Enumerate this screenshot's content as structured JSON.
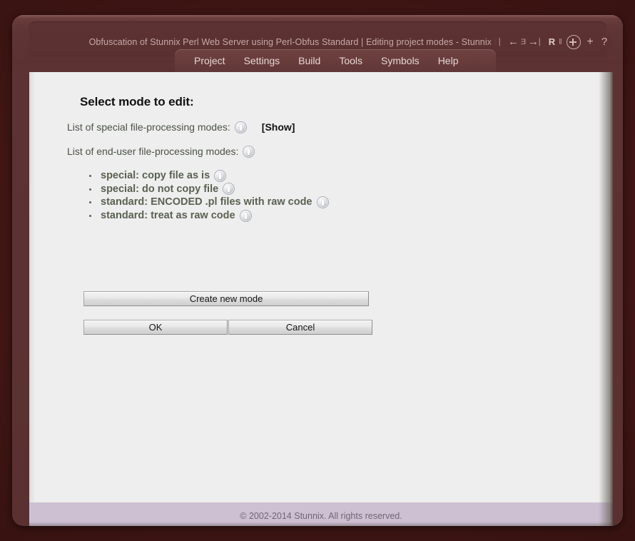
{
  "window": {
    "title": "Obfuscation of Stunnix Perl Web Server using Perl-Obfus Standard | Editing project modes - Stunnix Perl-Obfus P",
    "chrome_icons": [
      {
        "name": "bookmark-icon",
        "glyph": "⎸"
      },
      {
        "name": "back-arrow-icon",
        "glyph": "←"
      },
      {
        "name": "reload-icon",
        "glyph": "Ǝ"
      },
      {
        "name": "forward-arrow-icon",
        "glyph": "→"
      },
      {
        "name": "stop-icon",
        "glyph": "⎸"
      },
      {
        "name": "reader-icon",
        "glyph": "R"
      },
      {
        "name": "pause-icon",
        "glyph": "⏸"
      },
      {
        "name": "zoom-in-icon",
        "glyph": ""
      },
      {
        "name": "new-tab-icon",
        "glyph": "+"
      },
      {
        "name": "help-icon",
        "glyph": "?"
      }
    ]
  },
  "menu": {
    "items": [
      {
        "label": "Project"
      },
      {
        "label": "Settings"
      },
      {
        "label": "Build"
      },
      {
        "label": "Tools"
      },
      {
        "label": "Symbols"
      },
      {
        "label": "Help"
      }
    ]
  },
  "main": {
    "page_title": "Select mode to edit:",
    "special_label": "List of special file-processing modes:",
    "special_show_link": "[Show]",
    "enduser_label": "List of end-user file-processing modes:",
    "modes": [
      {
        "label": "special: copy file as is"
      },
      {
        "label": "special: do not copy file"
      },
      {
        "label": "standard: ENCODED .pl files with raw code"
      },
      {
        "label": "standard: treat as raw code"
      }
    ],
    "create_button": "Create new mode",
    "ok_button": "OK",
    "cancel_button": "Cancel"
  },
  "footer": {
    "copyright": "© 2002-2014 Stunnix. All rights reserved."
  },
  "colors": {
    "frame": "#5b3231",
    "desktop": "#3d1513",
    "page_bg": "#eeeeee",
    "footer_bg": "#cdc0d3",
    "mode_text": "#5a6152",
    "label_text": "#4a5147"
  }
}
